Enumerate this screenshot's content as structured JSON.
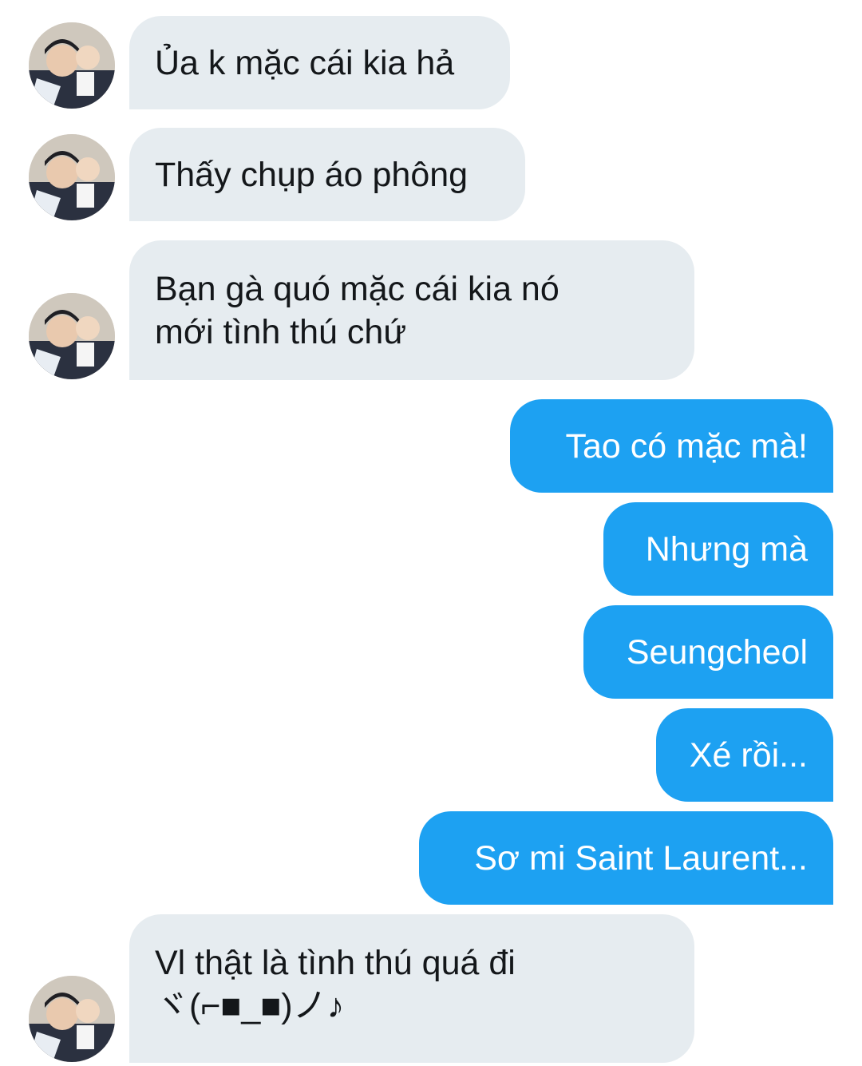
{
  "colors": {
    "incoming_bubble": "#e6ecf0",
    "outgoing_bubble": "#1da1f2",
    "incoming_text": "#14171a",
    "outgoing_text": "#ffffff"
  },
  "messages": [
    {
      "direction": "incoming",
      "lines": [
        "Ủa k mặc cái kia hả"
      ],
      "avatar": "contact-avatar"
    },
    {
      "direction": "incoming",
      "lines": [
        "Thấy chụp áo phông"
      ],
      "avatar": "contact-avatar"
    },
    {
      "direction": "incoming",
      "lines": [
        "Bạn gà quó mặc cái kia nó",
        "mới tình thú chứ"
      ],
      "avatar": "contact-avatar"
    },
    {
      "direction": "outgoing",
      "lines": [
        "Tao có mặc mà!"
      ]
    },
    {
      "direction": "outgoing",
      "lines": [
        "Nhưng mà"
      ]
    },
    {
      "direction": "outgoing",
      "lines": [
        "Seungcheol"
      ]
    },
    {
      "direction": "outgoing",
      "lines": [
        "Xé rồi..."
      ]
    },
    {
      "direction": "outgoing",
      "lines": [
        "Sơ mi Saint Laurent..."
      ]
    },
    {
      "direction": "incoming",
      "lines": [
        "Vl thật là tình thú quá đi",
        "ヾ(⌐■_■)ノ♪"
      ],
      "avatar": "contact-avatar"
    }
  ]
}
